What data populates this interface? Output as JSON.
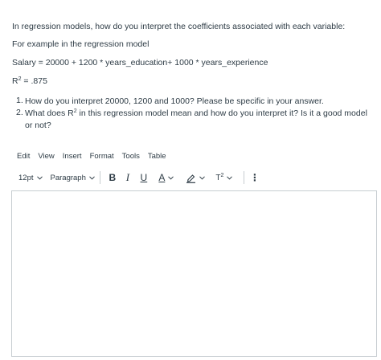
{
  "question": {
    "intro": "In regression models, how do you interpret the coefficients associated with each variable:",
    "example_label": "For example in the regression model",
    "equation": "Salary = 20000 + 1200 * years_education+ 1000 * years_experience",
    "r2_base": "R",
    "r2_sup": "2",
    "r2_value": " = .875",
    "items": [
      {
        "num": "1.",
        "text": "How do you interpret 20000, 1200 and 1000?  Please be specific in your answer."
      },
      {
        "num": "2.",
        "text_a": "What does R",
        "text_sup": "2",
        "text_b": " in this regression model mean and how do you interpret it? Is it a good model or not?"
      }
    ]
  },
  "editor": {
    "menu": [
      "Edit",
      "View",
      "Insert",
      "Format",
      "Tools",
      "Table"
    ],
    "font_size": "12pt",
    "block_format": "Paragraph",
    "bold": "B",
    "italic": "I",
    "underline": "U",
    "text_color": "A",
    "superscript_base": "T",
    "superscript_sup": "2",
    "more": "⋮",
    "content": ""
  },
  "icons": {
    "chevron": "chevron-down-icon",
    "highlight": "highlighter-icon",
    "more": "more-vertical-icon"
  }
}
